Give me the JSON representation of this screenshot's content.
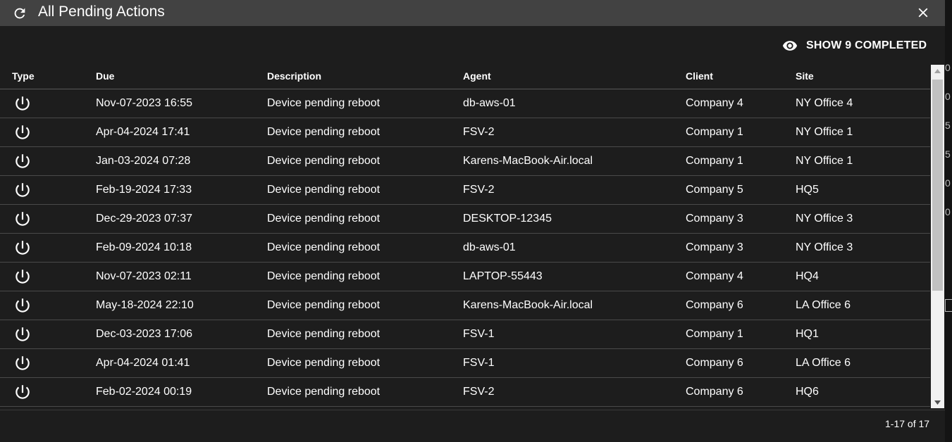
{
  "dialog": {
    "title": "All Pending Actions",
    "refresh_icon": "refresh-icon",
    "close_icon": "close-icon"
  },
  "toolbar": {
    "show_completed_label": "SHOW 9 COMPLETED",
    "eye_icon": "eye-icon"
  },
  "table": {
    "columns": [
      "Type",
      "Due",
      "Description",
      "Agent",
      "Client",
      "Site"
    ],
    "type_icon": "power-icon",
    "rows": [
      {
        "due": "Nov-07-2023 16:55",
        "description": "Device pending reboot",
        "agent": "db-aws-01",
        "client": "Company 4",
        "site": "NY Office 4"
      },
      {
        "due": "Apr-04-2024 17:41",
        "description": "Device pending reboot",
        "agent": "FSV-2",
        "client": "Company 1",
        "site": "NY Office 1"
      },
      {
        "due": "Jan-03-2024 07:28",
        "description": "Device pending reboot",
        "agent": "Karens-MacBook-Air.local",
        "client": "Company 1",
        "site": "NY Office 1"
      },
      {
        "due": "Feb-19-2024 17:33",
        "description": "Device pending reboot",
        "agent": "FSV-2",
        "client": "Company 5",
        "site": "HQ5"
      },
      {
        "due": "Dec-29-2023 07:37",
        "description": "Device pending reboot",
        "agent": "DESKTOP-12345",
        "client": "Company 3",
        "site": "NY Office 3"
      },
      {
        "due": "Feb-09-2024 10:18",
        "description": "Device pending reboot",
        "agent": "db-aws-01",
        "client": "Company 3",
        "site": "NY Office 3"
      },
      {
        "due": "Nov-07-2023 02:11",
        "description": "Device pending reboot",
        "agent": "LAPTOP-55443",
        "client": "Company 4",
        "site": "HQ4"
      },
      {
        "due": "May-18-2024 22:10",
        "description": "Device pending reboot",
        "agent": "Karens-MacBook-Air.local",
        "client": "Company 6",
        "site": "LA Office 6"
      },
      {
        "due": "Dec-03-2023 17:06",
        "description": "Device pending reboot",
        "agent": "FSV-1",
        "client": "Company 1",
        "site": "HQ1"
      },
      {
        "due": "Apr-04-2024 01:41",
        "description": "Device pending reboot",
        "agent": "FSV-1",
        "client": "Company 6",
        "site": "LA Office 6"
      },
      {
        "due": "Feb-02-2024 00:19",
        "description": "Device pending reboot",
        "agent": "FSV-2",
        "client": "Company 6",
        "site": "HQ6"
      }
    ]
  },
  "pagination": {
    "label": "1-17 of 17"
  },
  "background_fragments": [
    "0",
    "0",
    "5",
    "5",
    "0",
    "0"
  ],
  "colors": {
    "title_bar": "#424242",
    "dialog_bg": "#1d1d1d",
    "text": "#ffffff",
    "scrollbar_track": "#f1f1f1",
    "scrollbar_thumb": "#c1c1c1"
  }
}
